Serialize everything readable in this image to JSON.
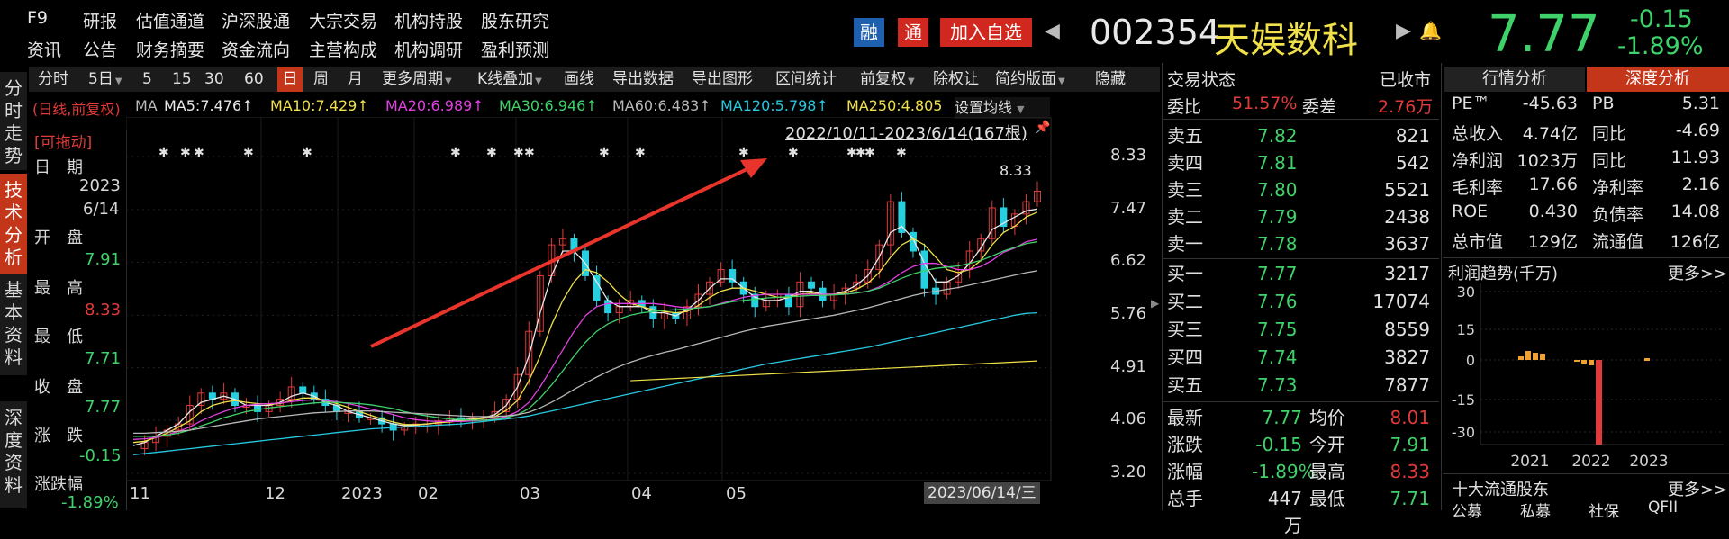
{
  "topnav": {
    "row1": [
      "F9",
      "研报",
      "估值通道",
      "沪深股通",
      "大宗交易",
      "机构持股",
      "股东研究"
    ],
    "row2": [
      "资讯",
      "公告",
      "财务摘要",
      "资金流向",
      "主营构成",
      "机构调研",
      "盈利预测"
    ]
  },
  "header": {
    "rong": "融",
    "tong": "通",
    "add_watch": "加入自选",
    "code": "002354",
    "name": "天娱数科",
    "price": "7.77",
    "change": "-0.15",
    "change_pct": "-1.89%",
    "colors": {
      "green": "#3fd16a",
      "red": "#e03a3a",
      "yellow": "#f0e04a",
      "accent": "#c4361a"
    }
  },
  "left_tabs": [
    {
      "label": "分时走势",
      "active": false
    },
    {
      "label": "技术分析",
      "active": true
    },
    {
      "label": "基本资料",
      "active": false
    },
    {
      "label": "深度资料",
      "active": false
    }
  ],
  "toolbar": {
    "items": [
      "分时",
      "5日",
      "5",
      "15",
      "30",
      "60",
      "日",
      "周",
      "月",
      "更多周期",
      "K线叠加",
      "画线",
      "导出数据",
      "导出图形",
      "区间统计",
      "前复权",
      "除权让",
      "简约版面",
      "隐藏"
    ],
    "active": "日"
  },
  "ma_legend": {
    "prefix": "(日线,前复权)",
    "ma": "MA",
    "items": [
      {
        "label": "MA5:7.476↑",
        "color": "#e8e8e8"
      },
      {
        "label": "MA10:7.429↑",
        "color": "#f0e04a"
      },
      {
        "label": "MA20:6.989↑",
        "color": "#e040e0"
      },
      {
        "label": "MA30:6.946↑",
        "color": "#3fd16a"
      },
      {
        "label": "MA60:6.483↑",
        "color": "#b8b8b8"
      },
      {
        "label": "MA120:5.798↑",
        "color": "#27c8e0"
      },
      {
        "label": "MA250:4.805",
        "color": "#f0e04a"
      }
    ],
    "settings": "设置均线"
  },
  "info": {
    "draggable": "[可拖动]",
    "date_label": "日　期",
    "year": "2023",
    "mmdd": "6/14",
    "open_label": "开　盘",
    "open": "7.91",
    "high_label": "最　高",
    "high": "8.33",
    "low_label": "最　低",
    "low": "7.71",
    "close_label": "收　盘",
    "close": "7.77",
    "chg_label": "涨　跌",
    "chg": "-0.15",
    "chgpct_label": "涨跌幅",
    "chgpct": "-1.89%"
  },
  "chart_data": {
    "type": "candlestick",
    "range_label": "2022/10/11-2023/6/14(167根)",
    "peak_label": "8.33",
    "cursor_date": "2023/06/14/三",
    "y_ticks": [
      "8.33",
      "7.47",
      "6.62",
      "5.76",
      "4.91",
      "4.06",
      "3.20"
    ],
    "y_values": [
      8.33,
      7.47,
      6.62,
      5.76,
      4.91,
      4.06,
      3.2
    ],
    "ylim": [
      3.2,
      8.33
    ],
    "x_ticks": [
      "11",
      "12",
      "2023",
      "02",
      "03",
      "04",
      "05"
    ],
    "series": [
      {
        "name": "close",
        "values": [
          3.6,
          3.7,
          3.8,
          3.9,
          4.0,
          4.3,
          4.5,
          4.4,
          4.5,
          4.3,
          4.3,
          4.2,
          4.3,
          4.4,
          4.6,
          4.5,
          4.4,
          4.3,
          4.2,
          4.2,
          4.1,
          4.1,
          4.0,
          3.9,
          3.95,
          4.0,
          4.0,
          4.05,
          4.1,
          4.05,
          4.1,
          4.1,
          4.2,
          4.4,
          4.8,
          5.5,
          6.4,
          6.9,
          7.0,
          6.8,
          6.4,
          6.0,
          5.8,
          5.9,
          6.0,
          5.9,
          5.7,
          5.8,
          5.7,
          5.9,
          6.1,
          6.3,
          6.5,
          6.3,
          6.1,
          5.9,
          6.0,
          6.1,
          5.9,
          6.3,
          6.2,
          6.0,
          6.1,
          6.2,
          6.3,
          6.5,
          6.9,
          7.6,
          7.1,
          6.8,
          6.2,
          6.1,
          6.3,
          6.5,
          6.8,
          7.0,
          7.5,
          7.2,
          7.4,
          7.6,
          7.77
        ]
      },
      {
        "name": "MA5",
        "values": [
          3.65,
          3.7,
          3.8,
          3.9,
          4.0,
          4.2,
          4.35,
          4.4,
          4.45,
          4.4,
          4.3,
          4.3,
          4.3,
          4.35,
          4.45,
          4.5,
          4.45,
          4.35,
          4.3,
          4.2,
          4.15,
          4.1,
          4.05,
          4.0,
          3.97,
          3.98,
          4.0,
          4.02,
          4.05,
          4.07,
          4.08,
          4.1,
          4.15,
          4.3,
          4.6,
          5.1,
          5.8,
          6.4,
          6.8,
          6.8,
          6.6,
          6.3,
          6.0,
          5.9,
          5.9,
          5.9,
          5.8,
          5.8,
          5.75,
          5.85,
          6.0,
          6.2,
          6.35,
          6.35,
          6.2,
          6.05,
          6.0,
          6.0,
          6.05,
          6.15,
          6.15,
          6.1,
          6.1,
          6.15,
          6.25,
          6.4,
          6.7,
          7.1,
          7.2,
          7.0,
          6.6,
          6.3,
          6.3,
          6.4,
          6.6,
          6.85,
          7.15,
          7.25,
          7.35,
          7.45,
          7.48
        ]
      },
      {
        "name": "MA10",
        "values": [
          3.7,
          3.72,
          3.78,
          3.85,
          3.95,
          4.05,
          4.2,
          4.3,
          4.35,
          4.38,
          4.35,
          4.33,
          4.32,
          4.33,
          4.38,
          4.42,
          4.42,
          4.38,
          4.33,
          4.27,
          4.2,
          4.14,
          4.08,
          4.03,
          3.99,
          3.99,
          4.0,
          4.02,
          4.03,
          4.05,
          4.07,
          4.09,
          4.12,
          4.22,
          4.38,
          4.7,
          5.1,
          5.6,
          6.0,
          6.3,
          6.5,
          6.45,
          6.3,
          6.1,
          5.95,
          5.9,
          5.85,
          5.82,
          5.8,
          5.82,
          5.92,
          6.05,
          6.15,
          6.2,
          6.2,
          6.15,
          6.1,
          6.05,
          6.05,
          6.1,
          6.12,
          6.1,
          6.1,
          6.12,
          6.18,
          6.28,
          6.45,
          6.7,
          6.9,
          7.0,
          6.9,
          6.7,
          6.5,
          6.45,
          6.5,
          6.65,
          6.9,
          7.1,
          7.2,
          7.35,
          7.43
        ]
      },
      {
        "name": "MA20",
        "values": [
          3.75,
          3.76,
          3.78,
          3.82,
          3.88,
          3.95,
          4.05,
          4.13,
          4.2,
          4.26,
          4.3,
          4.32,
          4.33,
          4.34,
          4.36,
          4.38,
          4.39,
          4.38,
          4.36,
          4.33,
          4.29,
          4.24,
          4.2,
          4.15,
          4.1,
          4.07,
          4.05,
          4.04,
          4.04,
          4.04,
          4.05,
          4.06,
          4.08,
          4.12,
          4.2,
          4.35,
          4.6,
          4.9,
          5.2,
          5.5,
          5.75,
          5.9,
          5.95,
          5.95,
          5.95,
          5.95,
          5.95,
          5.93,
          5.9,
          5.88,
          5.88,
          5.9,
          5.95,
          6.0,
          6.05,
          6.08,
          6.1,
          6.1,
          6.1,
          6.1,
          6.1,
          6.1,
          6.1,
          6.1,
          6.12,
          6.15,
          6.22,
          6.32,
          6.45,
          6.55,
          6.6,
          6.6,
          6.55,
          6.5,
          6.5,
          6.55,
          6.65,
          6.78,
          6.85,
          6.95,
          6.99
        ]
      },
      {
        "name": "MA30",
        "values": [
          3.8,
          3.8,
          3.8,
          3.82,
          3.85,
          3.9,
          3.97,
          4.03,
          4.1,
          4.15,
          4.2,
          4.23,
          4.26,
          4.28,
          4.3,
          4.32,
          4.34,
          4.35,
          4.35,
          4.34,
          4.33,
          4.31,
          4.28,
          4.25,
          4.2,
          4.16,
          4.13,
          4.1,
          4.08,
          4.07,
          4.06,
          4.06,
          4.07,
          4.1,
          4.15,
          4.25,
          4.42,
          4.63,
          4.86,
          5.1,
          5.32,
          5.5,
          5.62,
          5.7,
          5.76,
          5.8,
          5.82,
          5.84,
          5.85,
          5.86,
          5.88,
          5.9,
          5.94,
          5.98,
          6.0,
          6.02,
          6.04,
          6.05,
          6.06,
          6.07,
          6.08,
          6.08,
          6.09,
          6.1,
          6.12,
          6.15,
          6.2,
          6.28,
          6.36,
          6.43,
          6.48,
          6.52,
          6.54,
          6.56,
          6.6,
          6.65,
          6.72,
          6.8,
          6.86,
          6.92,
          6.95
        ]
      },
      {
        "name": "MA60",
        "values": [
          3.85,
          3.85,
          3.86,
          3.87,
          3.88,
          3.9,
          3.93,
          3.96,
          3.99,
          4.02,
          4.05,
          4.08,
          4.1,
          4.12,
          4.14,
          4.16,
          4.18,
          4.19,
          4.2,
          4.21,
          4.21,
          4.21,
          4.2,
          4.19,
          4.18,
          4.17,
          4.16,
          4.15,
          4.14,
          4.13,
          4.12,
          4.12,
          4.12,
          4.13,
          4.15,
          4.19,
          4.26,
          4.35,
          4.45,
          4.56,
          4.66,
          4.76,
          4.85,
          4.93,
          5.0,
          5.06,
          5.11,
          5.16,
          5.2,
          5.25,
          5.3,
          5.35,
          5.4,
          5.45,
          5.5,
          5.54,
          5.58,
          5.61,
          5.64,
          5.67,
          5.7,
          5.73,
          5.76,
          5.8,
          5.84,
          5.88,
          5.93,
          5.98,
          6.03,
          6.08,
          6.12,
          6.15,
          6.18,
          6.21,
          6.25,
          6.29,
          6.33,
          6.37,
          6.41,
          6.45,
          6.48
        ]
      },
      {
        "name": "MA120",
        "values": [
          3.5,
          3.52,
          3.54,
          3.56,
          3.58,
          3.6,
          3.62,
          3.64,
          3.66,
          3.68,
          3.7,
          3.72,
          3.74,
          3.76,
          3.78,
          3.8,
          3.82,
          3.84,
          3.86,
          3.88,
          3.9,
          3.92,
          3.93,
          3.94,
          3.95,
          3.96,
          3.97,
          3.98,
          3.99,
          4.0,
          4.02,
          4.04,
          4.06,
          4.08,
          4.1,
          4.13,
          4.17,
          4.21,
          4.25,
          4.29,
          4.33,
          4.37,
          4.41,
          4.45,
          4.49,
          4.53,
          4.57,
          4.61,
          4.65,
          4.69,
          4.73,
          4.77,
          4.81,
          4.85,
          4.89,
          4.93,
          4.97,
          5.0,
          5.03,
          5.06,
          5.09,
          5.12,
          5.15,
          5.18,
          5.21,
          5.24,
          5.28,
          5.32,
          5.36,
          5.4,
          5.44,
          5.48,
          5.52,
          5.56,
          5.6,
          5.64,
          5.68,
          5.72,
          5.76,
          5.79,
          5.8
        ]
      }
    ]
  },
  "order_book": {
    "title": "交易状态",
    "status": "已收市",
    "wei_bi_label": "委比",
    "wei_bi": "51.57%",
    "wei_cha_label": "委差",
    "wei_cha": "2.76万",
    "asks": [
      {
        "label": "卖五",
        "price": "7.82",
        "vol": "821",
        "color": "#e03a3a"
      },
      {
        "label": "卖四",
        "price": "7.81",
        "vol": "542",
        "color": "#e03a3a"
      },
      {
        "label": "卖三",
        "price": "7.80",
        "vol": "5521",
        "color": "#e03a3a"
      },
      {
        "label": "卖二",
        "price": "7.79",
        "vol": "2438",
        "color": "#e03a3a"
      },
      {
        "label": "卖一",
        "price": "7.78",
        "vol": "3637",
        "color": "#e03a3a"
      }
    ],
    "bids": [
      {
        "label": "买一",
        "price": "7.77",
        "vol": "3217"
      },
      {
        "label": "买二",
        "price": "7.76",
        "vol": "17074"
      },
      {
        "label": "买三",
        "price": "7.75",
        "vol": "8559"
      },
      {
        "label": "买四",
        "price": "7.74",
        "vol": "3827"
      },
      {
        "label": "买五",
        "price": "7.73",
        "vol": "7877"
      }
    ],
    "stats": [
      {
        "l1": "最新",
        "v1": "7.77",
        "l2": "均价",
        "v2": "8.01"
      },
      {
        "l1": "涨跌",
        "v1": "-0.15",
        "l2": "今开",
        "v2": "7.91"
      },
      {
        "l1": "涨幅",
        "v1": "-1.89%",
        "l2": "最高",
        "v2": "8.33"
      },
      {
        "l1": "总手",
        "v1": "447万",
        "l2": "最低",
        "v2": "7.71"
      }
    ]
  },
  "right_panel": {
    "tab1": "行情分析",
    "tab2": "深度分析",
    "fin": [
      {
        "l1": "PE™",
        "v1": "-45.63",
        "l2": "PB",
        "v2": "5.31"
      },
      {
        "l1": "总收入",
        "v1": "4.74亿",
        "l2": "同比",
        "v2": "-4.69"
      },
      {
        "l1": "净利润",
        "v1": "1023万",
        "l2": "同比",
        "v2": "11.93"
      },
      {
        "l1": "毛利率",
        "v1": "17.66",
        "l2": "净利率",
        "v2": "2.16"
      },
      {
        "l1": "ROE",
        "v1": "0.430",
        "l2": "负债率",
        "v2": "14.08"
      },
      {
        "l1": "总市值",
        "v1": "129亿",
        "l2": "流通值",
        "v2": "126亿"
      }
    ],
    "profit_title": "利润趋势(千万)",
    "more": "更多>>",
    "profit_y": [
      "30",
      "15",
      "0",
      "-15",
      "-30"
    ],
    "profit_x": [
      "2021",
      "2022",
      "2023"
    ],
    "top_holders": "十大流通股东",
    "more2": "更多>>",
    "holder_tabs": [
      "公募",
      "私募",
      "社保",
      "QFII"
    ]
  }
}
